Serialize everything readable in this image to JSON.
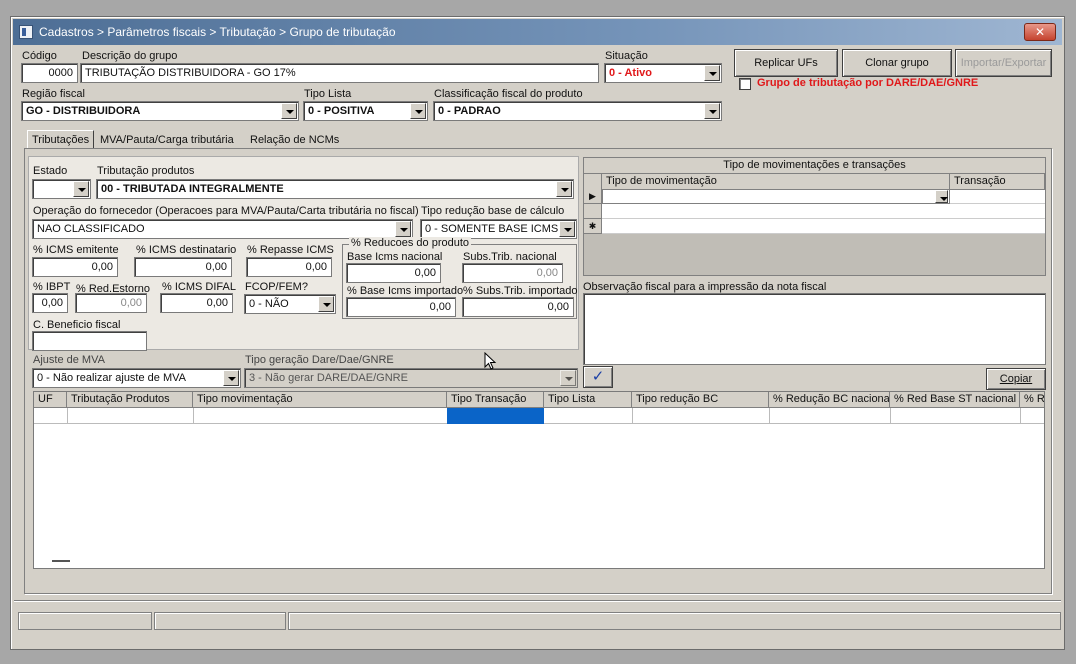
{
  "window": {
    "title": "Cadastros > Parâmetros fiscais > Tributação > Grupo de tributação",
    "close_glyph": "✕"
  },
  "header": {
    "codigo_label": "Código",
    "codigo_value": "0000",
    "descricao_label": "Descrição do grupo",
    "descricao_value": "TRIBUTAÇÃO DISTRIBUIDORA - GO 17%",
    "situacao_label": "Situação",
    "situacao_value": "0 - Ativo",
    "regiao_label": "Região fiscal",
    "regiao_value": "GO - DISTRIBUIDORA",
    "tipo_lista_label": "Tipo Lista",
    "tipo_lista_value": "0 - POSITIVA",
    "classificacao_label": "Classificação fiscal do produto",
    "classificacao_value": "0 - PADRAO",
    "replicar_label": "Replicar UFs",
    "clonar_label": "Clonar grupo",
    "importar_label": "Importar/Exportar",
    "dare_checkbox_label": "Grupo de tributação por DARE/DAE/GNRE"
  },
  "tabs": [
    {
      "label": "Tributações"
    },
    {
      "label": "MVA/Pauta/Carga tributária"
    },
    {
      "label": "Relação de NCMs"
    }
  ],
  "form": {
    "estado_label": "Estado",
    "estado_value": "",
    "trib_produtos_label": "Tributação produtos",
    "trib_produtos_value": "00 - TRIBUTADA INTEGRALMENTE",
    "operacao_label": "Operação do fornecedor (Operacoes para MVA/Pauta/Carta tributária no fiscal)",
    "operacao_value": "NAO CLASSIFICADO",
    "tipo_reducao_label": "Tipo redução base de cálculo",
    "tipo_reducao_value": "0 - SOMENTE BASE ICMS",
    "icms_emitente_label": "% ICMS emitente",
    "icms_emitente_value": "0,00",
    "icms_dest_label": "% ICMS destinatario",
    "icms_dest_value": "0,00",
    "repasse_label": "% Repasse ICMS",
    "repasse_value": "0,00",
    "reducoes_legend": "% Reducoes do produto",
    "base_nacional_label": "Base Icms nacional",
    "base_nacional_value": "0,00",
    "subs_nacional_label": "Subs.Trib. nacional",
    "subs_nacional_value": "0,00",
    "base_importado_label": "% Base Icms importado",
    "base_importado_value": "0,00",
    "subs_importado_label": "% Subs.Trib. importado",
    "subs_importado_value": "0,00",
    "ibpt_label": "% IBPT",
    "ibpt_value": "0,00",
    "red_estorno_label": "% Red.Estorno",
    "red_estorno_value": "0,00",
    "icms_difal_label": "% ICMS DIFAL",
    "icms_difal_value": "0,00",
    "fcop_label": "FCOP/FEM?",
    "fcop_value": "0 - NÃO",
    "beneficio_label": "C. Beneficio fiscal",
    "beneficio_value": ""
  },
  "movimentacoes": {
    "title": "Tipo de movimentações e transações",
    "col_tipo": "Tipo de movimentação",
    "col_transacao": "Transação",
    "row_indicator": "▶",
    "new_indicator": "✱"
  },
  "observacao_label": "Observação fiscal para a impressão da nota fiscal",
  "lower": {
    "ajuste_label": "Ajuste de MVA",
    "ajuste_value": "0 - Não realizar ajuste de MVA",
    "tipo_geracao_label": "Tipo geração Dare/Dae/GNRE",
    "tipo_geracao_value": "3 - Não gerar DARE/DAE/GNRE",
    "confirm_glyph": "✓",
    "copiar_label": "Copiar"
  },
  "grid": {
    "columns": [
      "UF",
      "Tributação Produtos",
      "Tipo movimentação",
      "Tipo Transação",
      "Tipo Lista",
      "Tipo redução BC",
      "% Redução BC nacional",
      "% Red Base ST nacional",
      "% Re"
    ]
  },
  "colors": {
    "title_bar": "#5b7aa2",
    "status_red": "#e0181a",
    "selection_blue": "#0a64c8",
    "confirm_blue": "#1b3fa6"
  }
}
